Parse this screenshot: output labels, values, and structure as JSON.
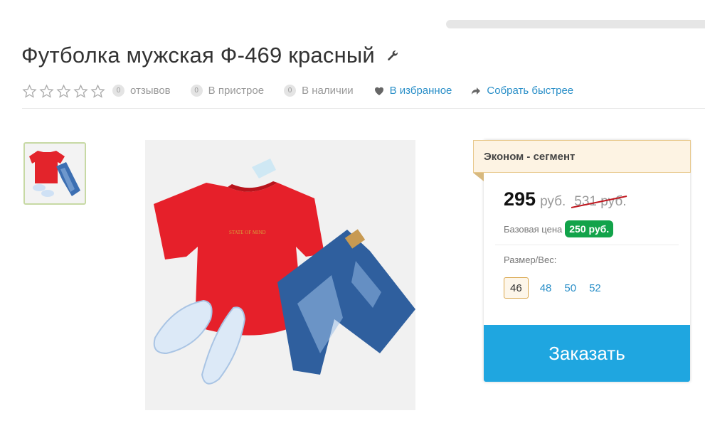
{
  "product": {
    "title": "Футболка мужская Ф-469 красный"
  },
  "meta": {
    "rating_stars": 0,
    "reviews_count": "0",
    "reviews_label": "отзывов",
    "compare_count": "0",
    "compare_label": "В пристрое",
    "stock_count": "0",
    "stock_label": "В наличии",
    "favorite_label": "В избранное",
    "quick_label": "Собрать быстрее"
  },
  "gallery": {
    "tshirt_print": "STATE OF MIND"
  },
  "pricing": {
    "segment": "Эконом - сегмент",
    "price": "295",
    "currency": "руб.",
    "old_price": "531 руб.",
    "base_label": "Базовая цена",
    "base_price": "250 руб.",
    "size_label": "Размер/Вес:",
    "sizes": [
      "46",
      "48",
      "50",
      "52"
    ],
    "selected_size": "46",
    "order_label": "Заказать"
  },
  "colors": {
    "accent_blue": "#1fa6e0",
    "link_blue": "#2a8fc8",
    "green_badge": "#12a34a",
    "segment_bg": "#fdf3e3"
  }
}
